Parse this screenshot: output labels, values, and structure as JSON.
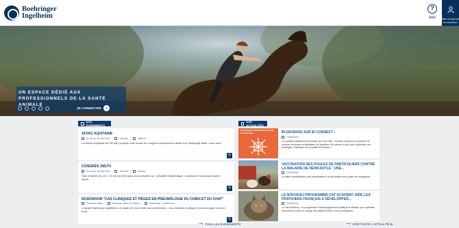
{
  "header": {
    "logo_line1": "Boehringer",
    "logo_line2": "Ingelheim",
    "help_label": "Aide",
    "account_label": "Mon compte de la connexion"
  },
  "hero": {
    "title": "UN ESPACE DÉDIÉ AUX PROFESSIONNELS DE LA SANTÉ ANIMALE",
    "connect_label": "SE CONNECTER"
  },
  "events": {
    "header_label": "NOS ÉVÉNEMENTS",
    "see_all": "TOUS LES ÉVÉNEMENTS",
    "items": [
      {
        "title": "AFVAC AQUITAINE",
        "date": "Du 24 au 25 mai 2018",
        "time": "Journée",
        "location": "Talence",
        "description": "La section Aquitaine de l'AFVAC propose cette année un Congrès exclusivement dédié à la Cardiologie féline. Vous avez..."
      },
      {
        "title": "CONGRÈS JNGTV",
        "date": "Du 16 au 18 mai 2018",
        "time": "Journée",
        "location": "Nantes",
        "description": "Tous à Nantes les 16,17 et 18 mai 2018 pour tout connaître sur : Actualité thérapeutique : nouveaux et nouveaux enjeux ! Après..."
      },
      {
        "title": "ROADSHOW \"CAS CLINIQUES ET PIÈGES EN PNEUMOLOGIE DU CHIEN ET DU CHAT\"",
        "date": "Plusieurs dates",
        "time": "Plusieurs villes en France",
        "location": "Roadshow - conférence",
        "description": "L'équipe Boehringer Ingelheim a le plaisir de vous inviter aux conférences : Cas cliniques et pièges en pneumologie du chien et du..."
      }
    ]
  },
  "news": {
    "header_label": "NOS ACTUALITÉS",
    "see_all": "VOIR TOUTE L'ACTUALITÉ BI",
    "items": [
      {
        "title": "BI ENVENUE SUR BI CONNECT !",
        "thumb_caption": "BI CONNECT, BIENVENUE ENTRE COLLÈGUES",
        "date": "14/05/2018",
        "description": "La nouvelle plateforme connectée qui vous relie... Pensée comme un concentré de services innovants et facilitateur du quotidien, BI connect a pour rôle d'optimiser vos échanges. Catalogue des produits et services..."
      },
      {
        "title": "VACCINATION DES POULES DE PARTICULIERS CONTRE LA MALADIE DE NEWCASTLE : UNE...",
        "date": "03/05/2018",
        "description": "La faible sensibilisation des propriétaires à la vaccination des poules de compagnie..."
      },
      {
        "title": "LE NOUVEAU PROGRAMME CAT ACADEMY AIDE LES PRATICIENS FRANÇAIS À DÉVELOPPER...",
        "date": "25/04/2018",
        "description": "La Cat Academy : un programme d'accompagnement pratique et efficace pour optimiser l'accueil et la prise en charge des patients félins, et leur propriétaire."
      }
    ]
  }
}
